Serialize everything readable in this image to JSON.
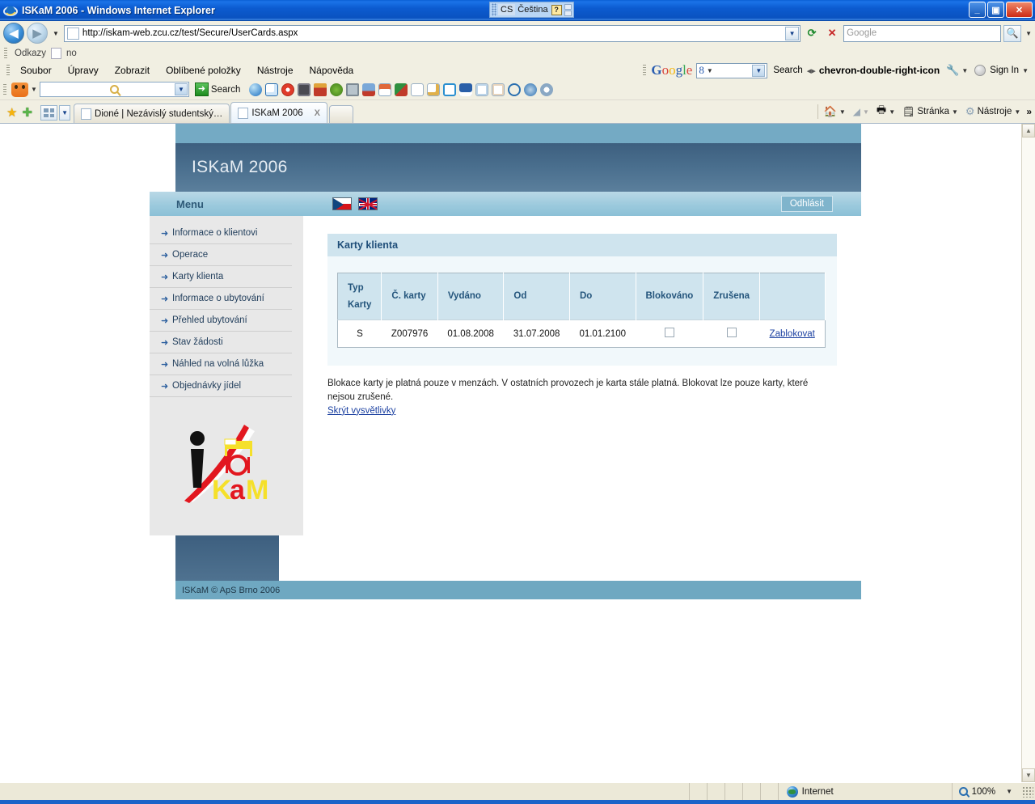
{
  "browser": {
    "title": "ISKaM 2006 - Windows Internet Explorer",
    "ie_icon": "ie-logo-icon",
    "language_bar": {
      "code": "CS",
      "name": "Čeština",
      "help": "?"
    },
    "window_buttons": {
      "minimize": "_",
      "maximize": "▣",
      "close": "✕"
    },
    "address": {
      "url": "http://iskam-web.zcu.cz/test/Secure/UserCards.aspx",
      "refresh_icon": "refresh-icon",
      "stop_icon": "stop-icon"
    },
    "search": {
      "placeholder": "Google",
      "go_icon": "search-icon"
    },
    "links_bar": {
      "label": "Odkazy",
      "item": "no"
    },
    "menu": [
      "Soubor",
      "Úpravy",
      "Zobrazit",
      "Oblíbené položky",
      "Nástroje",
      "Nápověda"
    ],
    "extra_toolbar": {
      "search_value": "",
      "search_label": "Search",
      "icons": [
        "globe-icon",
        "windows-icon",
        "lifebuoy-icon",
        "camera-icon",
        "jar-icon",
        "recycle-icon",
        "clock-icon",
        "download-icon",
        "list-icon",
        "flag-icon",
        "page-icon",
        "page-search-icon",
        "play-icon",
        "save-icon",
        "zoom-in-icon",
        "zoom-out-icon",
        "magnifier-icon",
        "help-icon",
        "gear-icon"
      ]
    },
    "google_toolbar": {
      "brand": "Google",
      "version": "8",
      "search_label": "Search",
      "more_icon": "chevron-double-right-icon",
      "wrench_icon": "wrench-icon",
      "sign_in": "Sign In"
    },
    "tabs": [
      {
        "label": "Dioné | Nezávislý studentský…",
        "active": false
      },
      {
        "label": "ISKaM 2006",
        "active": true,
        "close": "X"
      }
    ],
    "command_bar": {
      "home_icon": "home-icon",
      "feeds_icon": "rss-icon",
      "print_icon": "print-icon",
      "page": "Stránka",
      "tools": "Nástroje",
      "overflow": "»"
    },
    "statusbar": {
      "zone": "Internet",
      "zone_icon": "globe-icon",
      "zoom": "100%",
      "zoom_icon": "zoom-icon"
    }
  },
  "site": {
    "header_title": "ISKaM 2006",
    "menu_label": "Menu",
    "flags": [
      {
        "name": "flag-cz-icon",
        "title": "Čeština"
      },
      {
        "name": "flag-uk-icon",
        "title": "English"
      }
    ],
    "logout_label": "Odhlásit",
    "sidebar": [
      "Informace o klientovi",
      "Operace",
      "Karty klienta",
      "Informace o ubytování",
      "Přehled ubytování",
      "Stav žádosti",
      "Náhled na volná lůžka",
      "Objednávky jídel"
    ],
    "logo_alt": "ISKaM logo",
    "panel": {
      "title": "Karty klienta",
      "columns": [
        "Typ Karty",
        "Č. karty",
        "Vydáno",
        "Od",
        "Do",
        "Blokováno",
        "Zrušena",
        ""
      ],
      "column_typ_line1": "Typ",
      "column_typ_line2": "Karty",
      "rows": [
        {
          "typ": "S",
          "cislo": "Z007976",
          "vydano": "01.08.2008",
          "od": "31.07.2008",
          "do": "01.01.2100",
          "blokovano": false,
          "zrusena": false,
          "action": "Zablokovat"
        }
      ]
    },
    "note_text": "Blokace karty je platná pouze v menzách. V ostatních provozech je karta stále platná. Blokovat lze pouze karty, které nejsou zrušené.",
    "note_link": "Skrýt vysvětlivky",
    "footer": "ISKaM © ApS Brno 2006"
  },
  "colors": {
    "banner": "#4a6f8e",
    "banner_top": "#74aac4",
    "menu_bar": "#9ccadd",
    "panel_head": "#cfe4ee",
    "footer_bar": "#6fa8c1",
    "link": "#1a3fa0"
  }
}
